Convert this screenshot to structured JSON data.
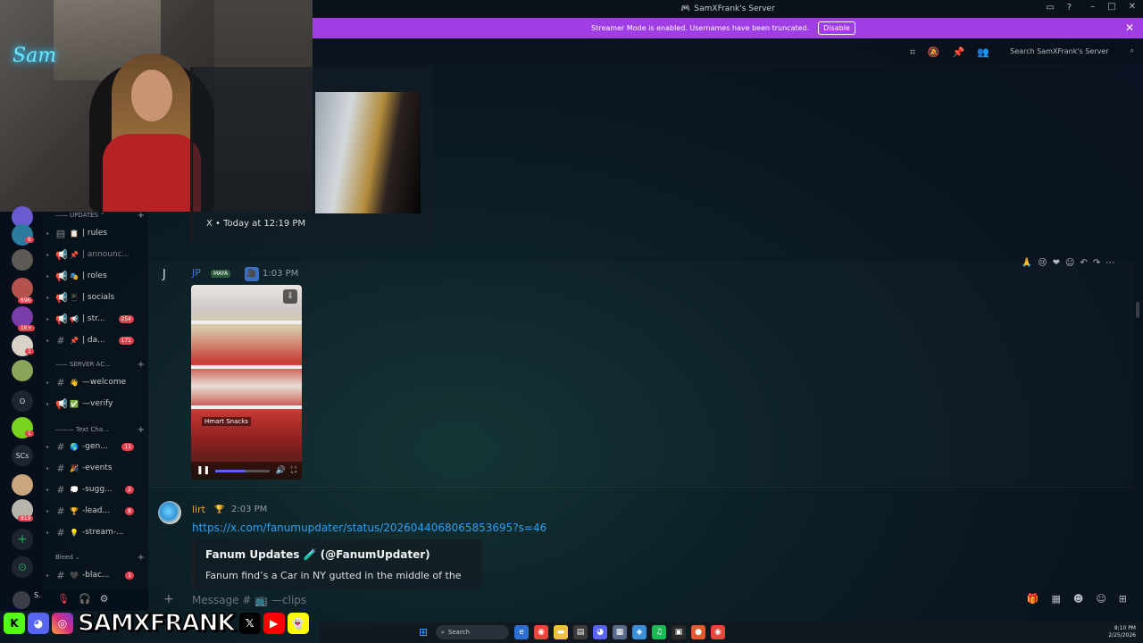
{
  "window": {
    "title": "SamXFrank's Server"
  },
  "banner": {
    "message": "Streamer Mode is enabled. Usernames have been truncated.",
    "disable_label": "Disable",
    "color": "#a03ee6"
  },
  "header": {
    "search_placeholder": "Search SamXFrank's Server"
  },
  "webcam": {
    "neon_sign": "Sam"
  },
  "rail": {
    "badges": [
      "6",
      "696",
      "1K+",
      "1",
      "1",
      "819"
    ],
    "text_servers": [
      "O",
      "SCs"
    ]
  },
  "sidebar": {
    "categories": {
      "updates": "UPDATES",
      "server_access": "SERVER AC...",
      "text_channels": "Text Cha...",
      "bleed": "Bleed"
    },
    "channels": [
      {
        "name": "| rules",
        "badge": ""
      },
      {
        "name": "| announc...",
        "badge": ""
      },
      {
        "name": "| roles",
        "badge": ""
      },
      {
        "name": "| socials",
        "badge": ""
      },
      {
        "name": "| str...",
        "badge": "254"
      },
      {
        "name": "| da...",
        "badge": "171"
      },
      {
        "name": "—welcome",
        "badge": ""
      },
      {
        "name": "—verify",
        "badge": ""
      },
      {
        "name": "-gen...",
        "badge": "11"
      },
      {
        "name": "-events",
        "badge": ""
      },
      {
        "name": "-sugg...",
        "badge": "2"
      },
      {
        "name": "-lead...",
        "badge": "8"
      },
      {
        "name": "-stream-...",
        "badge": ""
      },
      {
        "name": "-blac...",
        "badge": "1"
      }
    ]
  },
  "embed_top": {
    "footer": "X • Today at 12:19 PM"
  },
  "message1": {
    "author": "JP",
    "tag": "MAYA",
    "time": "1:03 PM",
    "video_caption": "Hmart Snacks",
    "progress": 0.55
  },
  "message2": {
    "author": "lirt",
    "time": "2:03 PM",
    "link": "https://x.com/fanumupdater/status/2026044068065853695?s=46",
    "embed_author": "Fanum Updates 🧪 (@FanumUpdater)",
    "embed_desc": "Fanum find’s a Car in NY gutted in the middle of the"
  },
  "composer": {
    "placeholder": "Message # 📺 —clips"
  },
  "user_panel": {
    "name": "S."
  },
  "overlay": {
    "brand": "SAMXFRANK"
  },
  "taskbar": {
    "search_label": "Search",
    "time": "8:10 PM",
    "date": "2/25/2026"
  }
}
